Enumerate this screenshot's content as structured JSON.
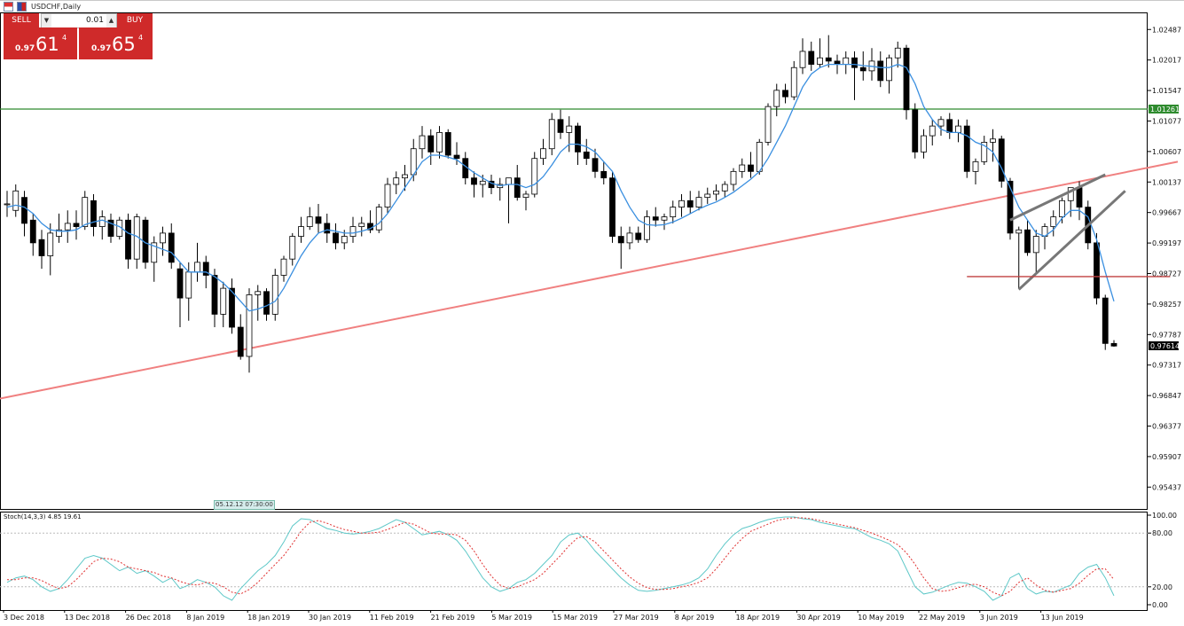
{
  "header": {
    "symbol": "USDCHF,Daily"
  },
  "trade_panel": {
    "sell_label": "SELL",
    "buy_label": "BUY",
    "lot_value": "0.01",
    "sell_price": {
      "prefix": "0.97",
      "big": "61",
      "sup": "4"
    },
    "buy_price": {
      "prefix": "0.97",
      "big": "65",
      "sup": "4"
    },
    "down_icon": "arrow-down",
    "up_icon": "arrow-up"
  },
  "time_badge": "05.12.12 07:30:00",
  "chart_data": [
    {
      "type": "candlestick",
      "symbol": "USDCHF",
      "timeframe": "Daily",
      "y_range": [
        0.951,
        1.0275
      ],
      "y_ticks": [
        "1.02487",
        "1.02017",
        "1.01547",
        "1.01077",
        "1.00607",
        "1.00137",
        "0.99667",
        "0.99197",
        "0.98727",
        "0.98257",
        "0.97787",
        "0.97317",
        "0.96847",
        "0.96377",
        "0.95907",
        "0.95437"
      ],
      "x_labels": [
        "3 Dec 2018",
        "13 Dec 2018",
        "26 Dec 2018",
        "8 Jan 2019",
        "18 Jan 2019",
        "30 Jan 2019",
        "11 Feb 2019",
        "21 Feb 2019",
        "5 Mar 2019",
        "15 Mar 2019",
        "27 Mar 2019",
        "8 Apr 2019",
        "18 Apr 2019",
        "30 Apr 2019",
        "10 May 2019",
        "22 May 2019",
        "3 Jun 2019",
        "13 Jun 2019"
      ],
      "current_price": "0.97614",
      "horizontal_level": {
        "value": 1.01261,
        "label": "1.01261",
        "color": "#2e8b2e"
      },
      "support_trendline": {
        "from": [
          0,
          0.968
        ],
        "to": [
          160,
          1.0045
        ],
        "color": "#f08080"
      },
      "ma_color": "#3a8fe0",
      "candles": [
        [
          0.998,
          1.0,
          0.996,
          0.998
        ],
        [
          0.997,
          1.001,
          0.996,
          1.0
        ],
        [
          0.999,
          1.0,
          0.993,
          0.995
        ],
        [
          0.9955,
          0.9965,
          0.99,
          0.992
        ],
        [
          0.9925,
          0.994,
          0.988,
          0.99
        ],
        [
          0.99,
          0.995,
          0.987,
          0.9935
        ],
        [
          0.993,
          0.9965,
          0.992,
          0.994
        ],
        [
          0.994,
          0.997,
          0.992,
          0.995
        ],
        [
          0.995,
          0.997,
          0.9925,
          0.9945
        ],
        [
          0.9945,
          1.0,
          0.994,
          0.999
        ],
        [
          0.9985,
          0.9995,
          0.993,
          0.9945
        ],
        [
          0.9945,
          0.997,
          0.9925,
          0.996
        ],
        [
          0.9955,
          0.9965,
          0.992,
          0.993
        ],
        [
          0.993,
          0.996,
          0.9925,
          0.9955
        ],
        [
          0.9955,
          0.9965,
          0.988,
          0.9895
        ],
        [
          0.9895,
          0.9965,
          0.988,
          0.996
        ],
        [
          0.9955,
          0.996,
          0.988,
          0.989
        ],
        [
          0.989,
          0.993,
          0.986,
          0.992
        ],
        [
          0.992,
          0.9945,
          0.99,
          0.9935
        ],
        [
          0.9935,
          0.995,
          0.988,
          0.989
        ],
        [
          0.988,
          0.989,
          0.979,
          0.9835
        ],
        [
          0.9835,
          0.989,
          0.98,
          0.9875
        ],
        [
          0.9875,
          0.992,
          0.986,
          0.989
        ],
        [
          0.989,
          0.99,
          0.985,
          0.987
        ],
        [
          0.987,
          0.988,
          0.979,
          0.981
        ],
        [
          0.981,
          0.986,
          0.979,
          0.985
        ],
        [
          0.985,
          0.9865,
          0.978,
          0.979
        ],
        [
          0.979,
          0.981,
          0.974,
          0.9745
        ],
        [
          0.9745,
          0.985,
          0.972,
          0.984
        ],
        [
          0.984,
          0.9855,
          0.98,
          0.9845
        ],
        [
          0.9845,
          0.985,
          0.98,
          0.981
        ],
        [
          0.981,
          0.988,
          0.98,
          0.987
        ],
        [
          0.987,
          0.99,
          0.986,
          0.9895
        ],
        [
          0.9895,
          0.9935,
          0.9885,
          0.993
        ],
        [
          0.993,
          0.996,
          0.992,
          0.9945
        ],
        [
          0.9945,
          0.9975,
          0.994,
          0.996
        ],
        [
          0.996,
          0.998,
          0.9935,
          0.995
        ],
        [
          0.995,
          0.9965,
          0.992,
          0.9935
        ],
        [
          0.9935,
          0.995,
          0.991,
          0.992
        ],
        [
          0.992,
          0.994,
          0.991,
          0.993
        ],
        [
          0.993,
          0.996,
          0.992,
          0.9945
        ],
        [
          0.9945,
          0.996,
          0.993,
          0.995
        ],
        [
          0.995,
          0.997,
          0.9935,
          0.994
        ],
        [
          0.994,
          0.998,
          0.9935,
          0.9975
        ],
        [
          0.9975,
          1.002,
          0.9965,
          1.001
        ],
        [
          1.001,
          1.003,
          0.9995,
          1.002
        ],
        [
          1.002,
          1.004,
          1.0,
          1.0025
        ],
        [
          1.0025,
          1.008,
          1.0015,
          1.0065
        ],
        [
          1.0065,
          1.01,
          1.005,
          1.0085
        ],
        [
          1.0085,
          1.0095,
          1.004,
          1.006
        ],
        [
          1.006,
          1.01,
          1.005,
          1.009
        ],
        [
          1.009,
          1.0095,
          1.005,
          1.0055
        ],
        [
          1.0055,
          1.0075,
          1.004,
          1.005
        ],
        [
          1.005,
          1.006,
          1.001,
          1.002
        ],
        [
          1.002,
          1.003,
          0.999,
          1.001
        ],
        [
          1.001,
          1.0025,
          0.999,
          1.0015
        ],
        [
          1.0015,
          1.0025,
          0.9995,
          1.0005
        ],
        [
          1.0005,
          1.002,
          0.9985,
          1.001
        ],
        [
          1.001,
          1.002,
          0.995,
          1.002
        ],
        [
          1.002,
          1.004,
          0.9985,
          0.999
        ],
        [
          0.999,
          1.0,
          0.997,
          0.9995
        ],
        [
          0.9995,
          1.006,
          0.999,
          1.005
        ],
        [
          1.005,
          1.008,
          1.004,
          1.0065
        ],
        [
          1.0065,
          1.012,
          1.0055,
          1.011
        ],
        [
          1.011,
          1.0125,
          1.008,
          1.009
        ],
        [
          1.009,
          1.0115,
          1.006,
          1.01
        ],
        [
          1.01,
          1.0105,
          1.004,
          1.006
        ],
        [
          1.006,
          1.008,
          1.004,
          1.005
        ],
        [
          1.005,
          1.0065,
          1.002,
          1.003
        ],
        [
          1.003,
          1.0045,
          1.001,
          1.002
        ],
        [
          1.002,
          1.003,
          0.992,
          0.993
        ],
        [
          0.993,
          0.9945,
          0.988,
          0.992
        ],
        [
          0.992,
          0.9945,
          0.991,
          0.9935
        ],
        [
          0.9935,
          0.9945,
          0.992,
          0.9925
        ],
        [
          0.9925,
          0.997,
          0.992,
          0.996
        ],
        [
          0.996,
          0.9975,
          0.9945,
          0.9955
        ],
        [
          0.9955,
          0.9965,
          0.994,
          0.996
        ],
        [
          0.996,
          0.9985,
          0.995,
          0.9975
        ],
        [
          0.9975,
          0.9995,
          0.996,
          0.9985
        ],
        [
          0.9985,
          1.0,
          0.9965,
          0.9975
        ],
        [
          0.9975,
          1.0,
          0.997,
          0.999
        ],
        [
          0.999,
          1.0005,
          0.998,
          0.9995
        ],
        [
          0.9995,
          1.001,
          0.9985,
          1.0
        ],
        [
          1.0,
          1.0015,
          0.999,
          1.001
        ],
        [
          1.001,
          1.0035,
          1.0,
          1.003
        ],
        [
          1.003,
          1.005,
          1.002,
          1.004
        ],
        [
          1.004,
          1.006,
          1.002,
          1.003
        ],
        [
          1.003,
          1.008,
          1.0025,
          1.0075
        ],
        [
          1.0075,
          1.0135,
          1.007,
          1.013
        ],
        [
          1.013,
          1.0165,
          1.0115,
          1.0155
        ],
        [
          1.0155,
          1.0165,
          1.0135,
          1.0145
        ],
        [
          1.0145,
          1.02,
          1.014,
          1.019
        ],
        [
          1.019,
          1.0235,
          1.018,
          1.0215
        ],
        [
          1.0215,
          1.023,
          1.0185,
          1.0195
        ],
        [
          1.0195,
          1.0235,
          1.019,
          1.0205
        ],
        [
          1.0205,
          1.024,
          1.019,
          1.02
        ],
        [
          1.02,
          1.021,
          1.018,
          1.0195
        ],
        [
          1.0195,
          1.0215,
          1.018,
          1.0205
        ],
        [
          1.0205,
          1.0215,
          1.014,
          1.019
        ],
        [
          1.019,
          1.0215,
          1.017,
          1.0185
        ],
        [
          1.0185,
          1.022,
          1.017,
          1.02
        ],
        [
          1.02,
          1.0215,
          1.016,
          1.017
        ],
        [
          1.017,
          1.021,
          1.015,
          1.0205
        ],
        [
          1.0205,
          1.023,
          1.019,
          1.022
        ],
        [
          1.022,
          1.0225,
          1.011,
          1.0125
        ],
        [
          1.0125,
          1.0135,
          1.005,
          1.006
        ],
        [
          1.006,
          1.0095,
          1.005,
          1.0085
        ],
        [
          1.0085,
          1.011,
          1.007,
          1.01
        ],
        [
          1.01,
          1.0115,
          1.0085,
          1.011
        ],
        [
          1.011,
          1.012,
          1.008,
          1.009
        ],
        [
          1.009,
          1.011,
          1.0075,
          1.01
        ],
        [
          1.01,
          1.011,
          1.002,
          1.003
        ],
        [
          1.003,
          1.005,
          1.001,
          1.0045
        ],
        [
          1.0045,
          1.0085,
          1.004,
          1.0075
        ],
        [
          1.0075,
          1.0095,
          1.0045,
          1.008
        ],
        [
          1.008,
          1.0085,
          1.0005,
          1.0015
        ],
        [
          1.0015,
          1.002,
          0.9925,
          0.9935
        ],
        [
          0.9935,
          0.9945,
          0.985,
          0.994
        ],
        [
          0.994,
          0.9955,
          0.99,
          0.9905
        ],
        [
          0.9905,
          0.994,
          0.9875,
          0.993
        ],
        [
          0.993,
          0.995,
          0.991,
          0.9945
        ],
        [
          0.9945,
          0.997,
          0.993,
          0.996
        ],
        [
          0.996,
          0.999,
          0.995,
          0.9985
        ],
        [
          0.9985,
          1.0,
          0.996,
          1.0005
        ],
        [
          1.0005,
          1.0015,
          0.9955,
          0.9975
        ],
        [
          0.9975,
          0.9985,
          0.991,
          0.992
        ],
        [
          0.992,
          0.9935,
          0.9825,
          0.9835
        ],
        [
          0.9835,
          0.984,
          0.9755,
          0.9765
        ],
        [
          0.9765,
          0.977,
          0.976,
          0.9761
        ]
      ],
      "ma": [
        0.9975,
        0.9978,
        0.9975,
        0.9965,
        0.995,
        0.994,
        0.9938,
        0.9938,
        0.994,
        0.9948,
        0.9952,
        0.9955,
        0.995,
        0.9945,
        0.9935,
        0.993,
        0.992,
        0.9915,
        0.991,
        0.9905,
        0.989,
        0.9875,
        0.9875,
        0.9875,
        0.9868,
        0.9858,
        0.9845,
        0.983,
        0.9815,
        0.9818,
        0.9823,
        0.983,
        0.985,
        0.9875,
        0.99,
        0.992,
        0.9935,
        0.994,
        0.9938,
        0.9935,
        0.9935,
        0.9938,
        0.9942,
        0.995,
        0.9965,
        0.9985,
        1.0005,
        1.0025,
        1.0045,
        1.0055,
        1.0055,
        1.0052,
        1.0048,
        1.0038,
        1.0028,
        1.002,
        1.0012,
        1.0008,
        1.001,
        1.001,
        1.0005,
        1.001,
        1.0022,
        1.004,
        1.006,
        1.0072,
        1.0072,
        1.0068,
        1.006,
        1.0045,
        1.003,
        1.0,
        0.9975,
        0.9955,
        0.9948,
        0.9947,
        0.9948,
        0.9952,
        0.9958,
        0.9965,
        0.9972,
        0.9978,
        0.9983,
        0.999,
        0.9998,
        1.0008,
        1.0018,
        1.003,
        1.005,
        1.0075,
        1.01,
        1.013,
        1.016,
        1.018,
        1.019,
        1.0195,
        1.0195,
        1.0195,
        1.0195,
        1.0193,
        1.0192,
        1.019,
        1.019,
        1.0195,
        1.019,
        1.0165,
        1.013,
        1.011,
        1.0095,
        1.009,
        1.009,
        1.0085,
        1.0075,
        1.007,
        1.006,
        1.0035,
        1.0005,
        0.9975,
        0.9955,
        0.9935,
        0.993,
        0.994,
        0.9958,
        0.997,
        0.997,
        0.996,
        0.9925,
        0.9875,
        0.983
      ]
    },
    {
      "type": "line",
      "title": "Stoch(14,3,3) 4.85 19.61",
      "y_range": [
        0,
        100
      ],
      "y_ticks": [
        "100.00",
        "80.00",
        "20.00",
        "0.00"
      ],
      "series": [
        {
          "name": "main",
          "color": "#5ec8c8",
          "values": [
            25,
            30,
            32,
            28,
            20,
            15,
            18,
            28,
            40,
            52,
            55,
            52,
            45,
            38,
            42,
            35,
            38,
            32,
            25,
            30,
            18,
            22,
            28,
            25,
            20,
            10,
            5,
            18,
            28,
            38,
            45,
            55,
            70,
            88,
            96,
            95,
            90,
            85,
            83,
            80,
            79,
            80,
            82,
            85,
            90,
            95,
            92,
            85,
            78,
            80,
            82,
            78,
            72,
            60,
            45,
            30,
            20,
            15,
            18,
            25,
            28,
            35,
            45,
            55,
            70,
            78,
            80,
            72,
            60,
            50,
            40,
            30,
            22,
            16,
            15,
            16,
            18,
            20,
            22,
            25,
            30,
            40,
            55,
            68,
            78,
            85,
            88,
            92,
            95,
            97,
            98,
            98,
            96,
            95,
            92,
            90,
            88,
            86,
            85,
            80,
            75,
            72,
            68,
            60,
            40,
            20,
            12,
            14,
            18,
            22,
            25,
            24,
            20,
            15,
            5,
            10,
            30,
            35,
            18,
            12,
            15,
            14,
            18,
            22,
            35,
            42,
            45,
            30,
            10
          ]
        },
        {
          "name": "signal",
          "color": "#e03030",
          "values": [
            28,
            28,
            30,
            30,
            27,
            22,
            18,
            20,
            28,
            38,
            48,
            52,
            51,
            48,
            42,
            40,
            38,
            36,
            32,
            30,
            26,
            23,
            22,
            25,
            24,
            20,
            14,
            12,
            17,
            25,
            35,
            45,
            55,
            68,
            82,
            92,
            94,
            91,
            87,
            84,
            82,
            80,
            80,
            81,
            84,
            88,
            92,
            90,
            85,
            80,
            79,
            79,
            78,
            72,
            60,
            45,
            32,
            22,
            18,
            20,
            24,
            28,
            35,
            45,
            55,
            66,
            75,
            76,
            70,
            60,
            50,
            40,
            31,
            24,
            19,
            17,
            17,
            18,
            20,
            22,
            25,
            30,
            40,
            52,
            64,
            74,
            82,
            86,
            90,
            94,
            96,
            97,
            97,
            96,
            94,
            92,
            90,
            88,
            86,
            83,
            80,
            76,
            72,
            67,
            58,
            45,
            30,
            18,
            15,
            16,
            19,
            22,
            23,
            20,
            14,
            10,
            15,
            25,
            30,
            22,
            16,
            14,
            16,
            18,
            24,
            33,
            40,
            40,
            28
          ]
        }
      ],
      "levels": [
        80,
        20
      ]
    }
  ]
}
